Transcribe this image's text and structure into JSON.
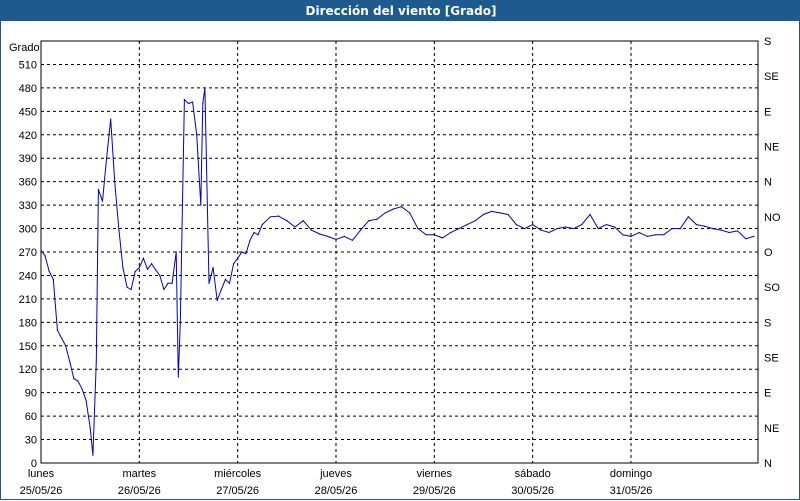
{
  "window": {
    "title": "Dirección del viento [Grado]"
  },
  "colors": {
    "title_bar": "#1f5a8f",
    "line": "#0000cc",
    "grid": "#000000",
    "background": "#ffffff"
  },
  "chart_data": {
    "type": "line",
    "title": "Dirección del viento [Grado]",
    "ylabel": "Grado",
    "ylim": [
      0,
      540
    ],
    "yticks": [
      0,
      30,
      60,
      90,
      120,
      150,
      180,
      210,
      240,
      270,
      300,
      330,
      360,
      390,
      420,
      450,
      480,
      510
    ],
    "y2_labels": [
      "N",
      "NE",
      "E",
      "SE",
      "S",
      "SO",
      "O",
      "NO",
      "N",
      "NE",
      "E",
      "SE",
      "S"
    ],
    "xlim": [
      "2026-05-25T00:00",
      "2026-06-01T07:00"
    ],
    "x_tick_dates": [
      "2026-05-25T00:00",
      "2026-05-26T00:00",
      "2026-05-27T00:00",
      "2026-05-28T00:00",
      "2026-05-29T00:00",
      "2026-05-30T00:00",
      "2026-05-31T00:00"
    ],
    "x_tick_labels": [
      [
        "lunes",
        "25/05/26"
      ],
      [
        "martes",
        "26/05/26"
      ],
      [
        "miércoles",
        "27/05/26"
      ],
      [
        "jueves",
        "28/05/26"
      ],
      [
        "viernes",
        "29/05/26"
      ],
      [
        "sábado",
        "30/05/26"
      ],
      [
        "domingo",
        "31/05/26"
      ]
    ],
    "grid": true,
    "series": [
      {
        "points": [
          [
            "2026-05-25T00:00",
            272
          ],
          [
            "2026-05-25T01:00",
            265
          ],
          [
            "2026-05-25T02:00",
            245
          ],
          [
            "2026-05-25T03:00",
            235
          ],
          [
            "2026-05-25T04:00",
            170
          ],
          [
            "2026-05-25T05:00",
            160
          ],
          [
            "2026-05-25T06:00",
            150
          ],
          [
            "2026-05-25T07:00",
            130
          ],
          [
            "2026-05-25T08:00",
            108
          ],
          [
            "2026-05-25T09:00",
            105
          ],
          [
            "2026-05-25T10:00",
            95
          ],
          [
            "2026-05-25T11:00",
            80
          ],
          [
            "2026-05-25T12:00",
            45
          ],
          [
            "2026-05-25T12:40",
            10
          ],
          [
            "2026-05-25T13:30",
            130
          ],
          [
            "2026-05-25T14:00",
            350
          ],
          [
            "2026-05-25T15:00",
            335
          ],
          [
            "2026-05-25T16:00",
            390
          ],
          [
            "2026-05-25T17:00",
            440
          ],
          [
            "2026-05-25T18:00",
            360
          ],
          [
            "2026-05-25T19:00",
            300
          ],
          [
            "2026-05-25T20:00",
            250
          ],
          [
            "2026-05-25T21:00",
            225
          ],
          [
            "2026-05-25T22:00",
            222
          ],
          [
            "2026-05-25T23:00",
            245
          ],
          [
            "2026-05-26T00:00",
            250
          ],
          [
            "2026-05-26T01:00",
            262
          ],
          [
            "2026-05-26T02:00",
            248
          ],
          [
            "2026-05-26T03:00",
            255
          ],
          [
            "2026-05-26T04:00",
            247
          ],
          [
            "2026-05-26T05:00",
            240
          ],
          [
            "2026-05-26T06:00",
            222
          ],
          [
            "2026-05-26T07:00",
            230
          ],
          [
            "2026-05-26T08:00",
            230
          ],
          [
            "2026-05-26T09:00",
            270
          ],
          [
            "2026-05-26T09:30",
            110
          ],
          [
            "2026-05-26T10:00",
            180
          ],
          [
            "2026-05-26T11:00",
            465
          ],
          [
            "2026-05-26T12:00",
            460
          ],
          [
            "2026-05-26T13:00",
            462
          ],
          [
            "2026-05-26T14:00",
            420
          ],
          [
            "2026-05-26T15:00",
            330
          ],
          [
            "2026-05-26T15:30",
            460
          ],
          [
            "2026-05-26T16:00",
            480
          ],
          [
            "2026-05-26T17:00",
            230
          ],
          [
            "2026-05-26T18:00",
            250
          ],
          [
            "2026-05-26T19:00",
            208
          ],
          [
            "2026-05-26T20:00",
            222
          ],
          [
            "2026-05-26T21:00",
            235
          ],
          [
            "2026-05-26T22:00",
            230
          ],
          [
            "2026-05-26T23:00",
            255
          ],
          [
            "2026-05-27T00:00",
            262
          ],
          [
            "2026-05-27T01:00",
            270
          ],
          [
            "2026-05-27T02:00",
            268
          ],
          [
            "2026-05-27T03:00",
            285
          ],
          [
            "2026-05-27T04:00",
            295
          ],
          [
            "2026-05-27T05:00",
            292
          ],
          [
            "2026-05-27T06:00",
            305
          ],
          [
            "2026-05-27T08:00",
            315
          ],
          [
            "2026-05-27T10:00",
            316
          ],
          [
            "2026-05-27T12:00",
            310
          ],
          [
            "2026-05-27T14:00",
            302
          ],
          [
            "2026-05-27T16:00",
            310
          ],
          [
            "2026-05-27T18:00",
            298
          ],
          [
            "2026-05-27T20:00",
            293
          ],
          [
            "2026-05-27T22:00",
            290
          ],
          [
            "2026-05-28T00:00",
            286
          ],
          [
            "2026-05-28T02:00",
            290
          ],
          [
            "2026-05-28T04:00",
            285
          ],
          [
            "2026-05-28T06:00",
            298
          ],
          [
            "2026-05-28T08:00",
            310
          ],
          [
            "2026-05-28T10:00",
            312
          ],
          [
            "2026-05-28T12:00",
            320
          ],
          [
            "2026-05-28T14:00",
            325
          ],
          [
            "2026-05-28T16:00",
            328
          ],
          [
            "2026-05-28T18:00",
            320
          ],
          [
            "2026-05-28T20:00",
            300
          ],
          [
            "2026-05-28T22:00",
            292
          ],
          [
            "2026-05-29T00:00",
            292
          ],
          [
            "2026-05-29T02:00",
            288
          ],
          [
            "2026-05-29T04:00",
            295
          ],
          [
            "2026-05-29T06:00",
            300
          ],
          [
            "2026-05-29T08:00",
            305
          ],
          [
            "2026-05-29T10:00",
            310
          ],
          [
            "2026-05-29T12:00",
            318
          ],
          [
            "2026-05-29T14:00",
            322
          ],
          [
            "2026-05-29T16:00",
            320
          ],
          [
            "2026-05-29T18:00",
            318
          ],
          [
            "2026-05-29T20:00",
            305
          ],
          [
            "2026-05-29T22:00",
            300
          ],
          [
            "2026-05-30T00:00",
            305
          ],
          [
            "2026-05-30T02:00",
            298
          ],
          [
            "2026-05-30T04:00",
            295
          ],
          [
            "2026-05-30T06:00",
            300
          ],
          [
            "2026-05-30T08:00",
            302
          ],
          [
            "2026-05-30T10:00",
            300
          ],
          [
            "2026-05-30T12:00",
            305
          ],
          [
            "2026-05-30T14:00",
            318
          ],
          [
            "2026-05-30T16:00",
            300
          ],
          [
            "2026-05-30T18:00",
            305
          ],
          [
            "2026-05-30T20:00",
            302
          ],
          [
            "2026-05-30T22:00",
            292
          ],
          [
            "2026-05-31T00:00",
            290
          ],
          [
            "2026-05-31T02:00",
            295
          ],
          [
            "2026-05-31T04:00",
            290
          ],
          [
            "2026-05-31T06:00",
            292
          ],
          [
            "2026-05-31T08:00",
            292
          ],
          [
            "2026-05-31T10:00",
            300
          ],
          [
            "2026-05-31T12:00",
            300
          ],
          [
            "2026-05-31T14:00",
            315
          ],
          [
            "2026-05-31T16:00",
            305
          ],
          [
            "2026-05-31T18:00",
            303
          ],
          [
            "2026-05-31T20:00",
            300
          ],
          [
            "2026-05-31T22:00",
            298
          ],
          [
            "2026-06-01T00:00",
            295
          ],
          [
            "2026-06-01T02:00",
            297
          ],
          [
            "2026-06-01T04:00",
            287
          ],
          [
            "2026-06-01T06:00",
            290
          ]
        ]
      }
    ]
  }
}
